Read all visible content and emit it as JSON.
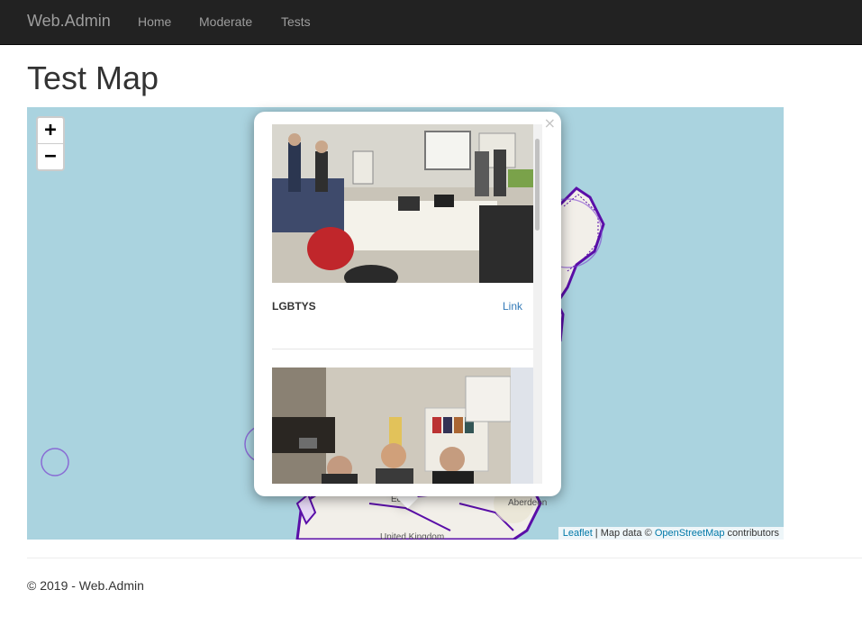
{
  "navbar": {
    "brand": "Web.Admin",
    "links": [
      "Home",
      "Moderate",
      "Tests"
    ]
  },
  "page": {
    "title": "Test Map"
  },
  "map": {
    "zoom_in": "+",
    "zoom_out": "−",
    "labels": {
      "aberdeen": "Aberdeen",
      "united_kingdom": "United Kingdom",
      "edinburgh_partial": "Edin"
    },
    "attribution": {
      "leaflet": "Leaflet",
      "separator": " | Map data © ",
      "osm": "OpenStreetMap",
      "suffix": " contributors"
    },
    "popup": {
      "close": "×",
      "items": [
        {
          "title": "LGBTYS",
          "link": "Link"
        }
      ]
    }
  },
  "footer": {
    "text": "© 2019 - Web.Admin"
  },
  "colors": {
    "navbar": "#222222",
    "sea": "#aad3df",
    "boundary": "#5a0ea8",
    "link": "#337ab7"
  }
}
